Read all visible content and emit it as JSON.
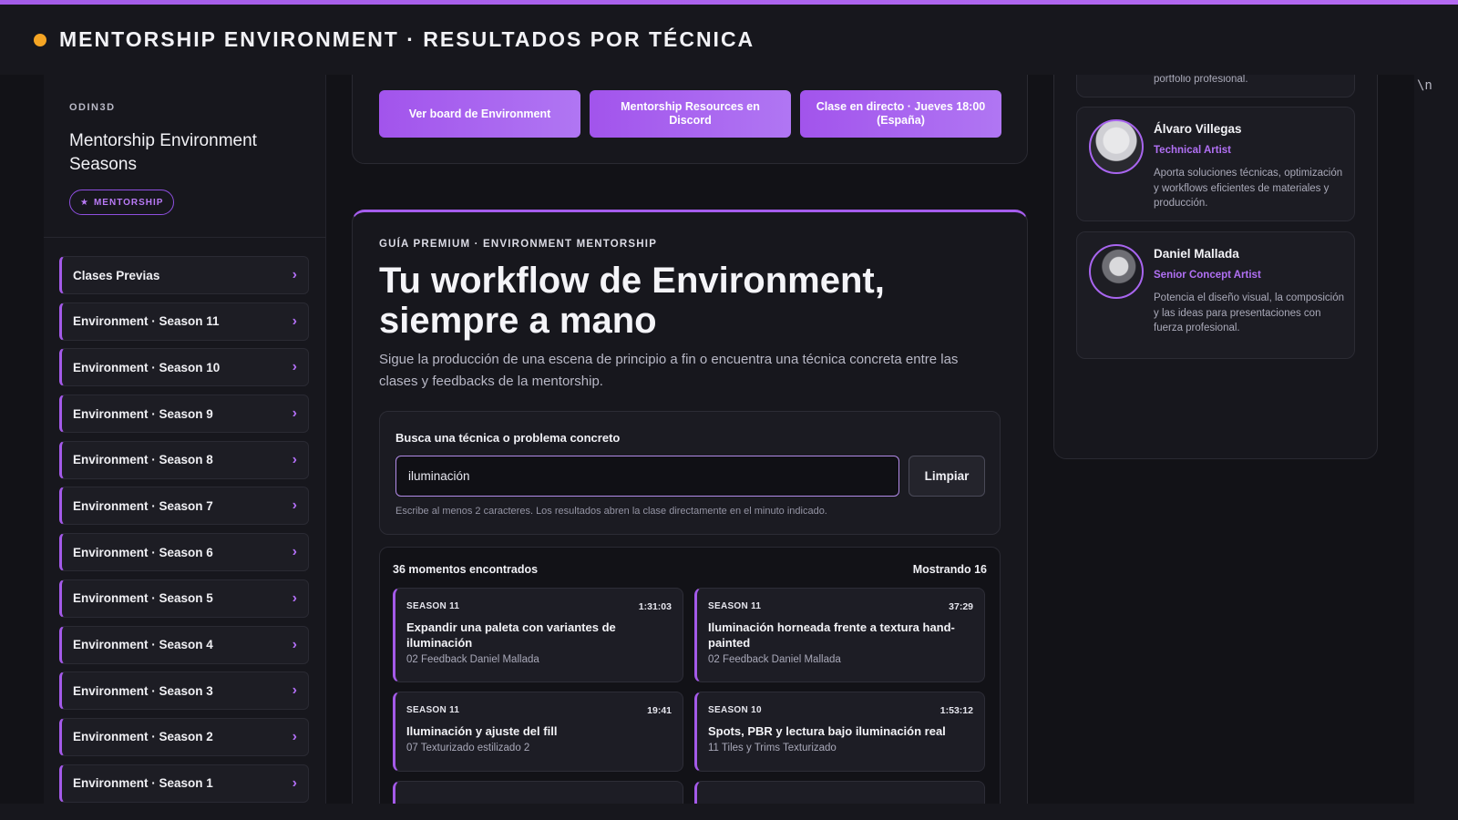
{
  "header": {
    "title": "MENTORSHIP ENVIRONMENT · RESULTADOS POR TÉCNICA",
    "dot_color": "#f5a524"
  },
  "sidebar": {
    "brand": "ODIN3D",
    "title": "Mentorship Environment Seasons",
    "badge": "MENTORSHIP",
    "items": [
      {
        "label": "Clases Previas"
      },
      {
        "label": "Environment · Season 11"
      },
      {
        "label": "Environment · Season 10"
      },
      {
        "label": "Environment · Season 9"
      },
      {
        "label": "Environment · Season 8"
      },
      {
        "label": "Environment · Season 7"
      },
      {
        "label": "Environment · Season 6"
      },
      {
        "label": "Environment · Season 5"
      },
      {
        "label": "Environment · Season 4"
      },
      {
        "label": "Environment · Season 3"
      },
      {
        "label": "Environment · Season 2"
      },
      {
        "label": "Environment · Season 1"
      }
    ]
  },
  "actions": {
    "board": "Ver board de Environment",
    "discord": "Mentorship Resources en Discord",
    "live": "Clase en directo · Jueves 18:00 (España)"
  },
  "main": {
    "eyebrow": "GUÍA PREMIUM · ENVIRONMENT MENTORSHIP",
    "title": "Tu workflow de Environment, siempre a mano",
    "description": "Sigue la producción de una escena de principio a fin o encuentra una técnica concreta entre las clases y feedbacks de la mentorship."
  },
  "search": {
    "label": "Busca una técnica o problema concreto",
    "value": "iluminación",
    "clear": "Limpiar",
    "hint": "Escribe al menos 2 caracteres. Los resultados abren la clase directamente en el minuto indicado."
  },
  "results": {
    "count": "36 momentos encontrados",
    "showing": "Mostrando 16",
    "items": [
      {
        "season": "SEASON 11",
        "time": "1:31:03",
        "title": "Expandir una paleta con variantes de iluminación",
        "sub": "02 Feedback Daniel Mallada"
      },
      {
        "season": "SEASON 11",
        "time": "37:29",
        "title": "Iluminación horneada frente a textura hand-painted",
        "sub": "02 Feedback Daniel Mallada"
      },
      {
        "season": "SEASON 11",
        "time": "19:41",
        "title": "Iluminación y ajuste del fill",
        "sub": "07 Texturizado estilizado 2"
      },
      {
        "season": "SEASON 10",
        "time": "1:53:12",
        "title": "Spots, PBR y lectura bajo iluminación real",
        "sub": "11 Tiles y Trims Texturizado"
      }
    ]
  },
  "mentors": {
    "partial_desc": "portfolio profesional.",
    "items": [
      {
        "name": "Álvaro Villegas",
        "role": "Technical Artist",
        "desc": "Aporta soluciones técnicas, optimización y workflows eficientes de materiales y producción."
      },
      {
        "name": "Daniel Mallada",
        "role": "Senior Concept Artist",
        "desc": "Potencia el diseño visual, la composición y las ideas para presentaciones con fuerza profesional."
      }
    ]
  },
  "misc": {
    "stray_text": "\\n"
  },
  "colors": {
    "accent": "#a55ded",
    "background": "#121217",
    "panel": "#17171d"
  }
}
